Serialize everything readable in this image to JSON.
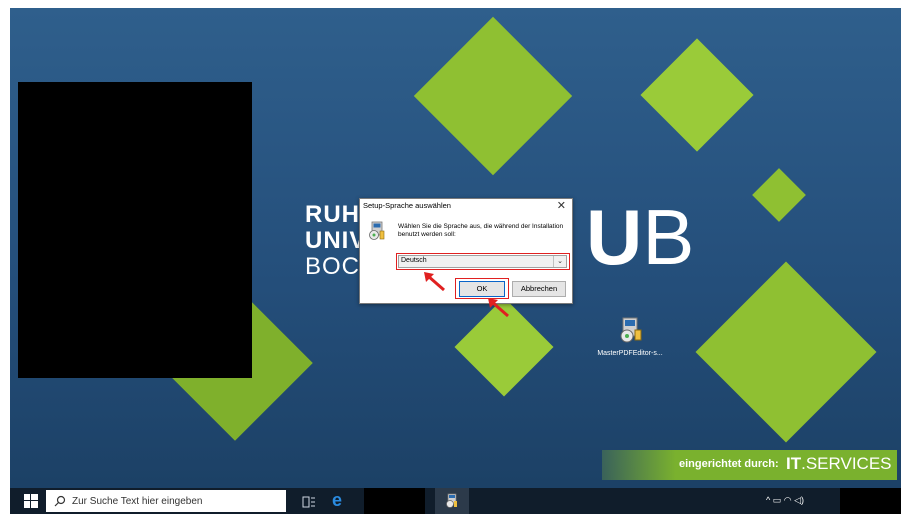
{
  "desktop": {
    "logo_line1": "RUH",
    "logo_line2": "UNIV",
    "logo_line3": "BOCH",
    "ub_u": "U",
    "ub_b": "B",
    "ribbon_text": "eingerichtet durch:",
    "ribbon_brand_bold": "IT",
    "ribbon_brand_rest": ".SERVICES",
    "accent_color": "#8fc032",
    "background_color": "#2f5f8c",
    "desktop_icon": {
      "label": "MasterPDFEditor-s...",
      "icon": "installer-icon"
    }
  },
  "dialog": {
    "title": "Setup-Sprache auswählen",
    "close_symbol": "✕",
    "message": "Wählen Sie die Sprache aus, die während der Installation benutzt werden soll:",
    "language_selected": "Deutsch",
    "dropdown_arrow": "⌄",
    "ok_label": "OK",
    "cancel_label": "Abbrechen",
    "highlight_color": "#e02020"
  },
  "taskbar": {
    "search_placeholder": "Zur Suche Text hier eingeben",
    "edge_glyph": "e",
    "tray_glyphs": "^  ▭  ◠  ◁)"
  }
}
